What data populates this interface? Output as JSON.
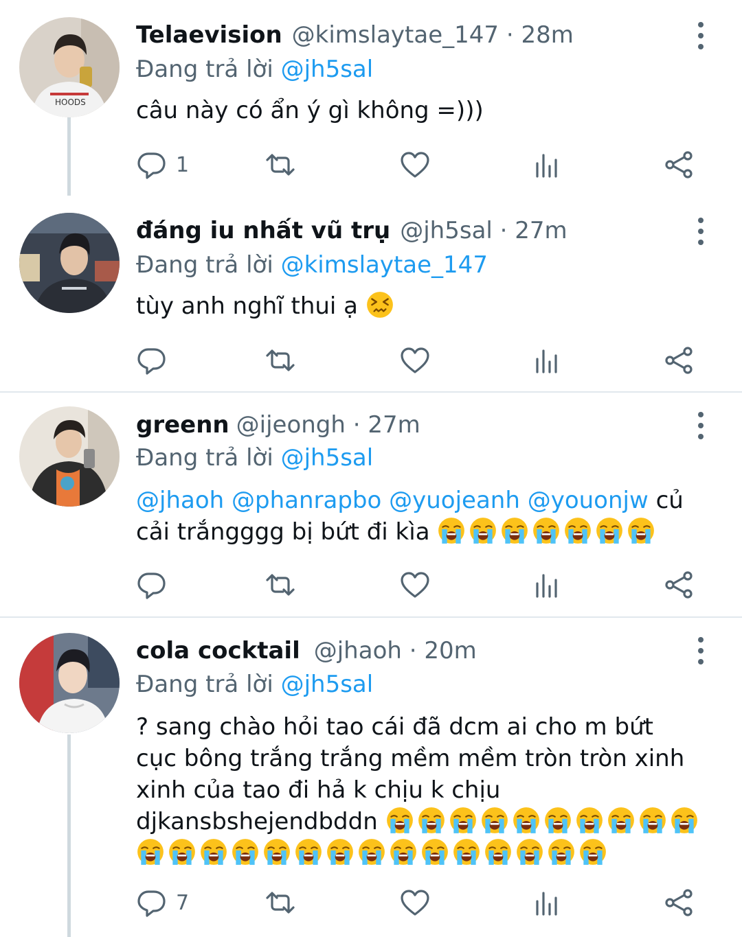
{
  "tweets": [
    {
      "name": "Telaevision",
      "handle": "@kimslaytae_147",
      "time": "28m",
      "reply_prefix": "Đang trả lời",
      "reply_to": "@jh5sal",
      "text": "câu này có ẩn ý gì không =)))",
      "replies": "1"
    },
    {
      "name": "đáng iu nhất vũ trụ",
      "handle": "@jh5sal",
      "time": "27m",
      "reply_prefix": "Đang trả lời",
      "reply_to": "@kimslaytae_147",
      "text": "tùy anh nghĩ thui ạ",
      "emoji": "confounded-face",
      "replies": ""
    },
    {
      "name": "greenn",
      "handle": "@ijeongh",
      "time": "27m",
      "reply_prefix": "Đang trả lời",
      "reply_to": "@jh5sal",
      "mentions": [
        "@jhaoh",
        "@phanrapbo",
        "@yuojeanh",
        "@youonjw"
      ],
      "text_after_mentions": "củ",
      "text_line2": "cải trắngggg bị bứt đi kìa",
      "emoji": "loudly-crying-face",
      "emoji_count": 7,
      "replies": ""
    },
    {
      "name": "cola cocktail",
      "handle": "@jhaoh",
      "time": "20m",
      "reply_prefix": "Đang trả lời",
      "reply_to": "@jh5sal",
      "text_lines": [
        "? sang chào hỏi tao cái đã dcm ai cho m bứt",
        "cục bông trắng trắng mềm mềm tròn tròn xinh",
        "xinh của tao đi hả k chịu k chịu",
        "djkansbshejendbddn"
      ],
      "emoji": "loudly-crying-face",
      "emoji_count_line4": 10,
      "emoji_count_line5": 15,
      "replies": "7"
    }
  ],
  "colors": {
    "text": "#0f1419",
    "secondary": "#536471",
    "mention": "#1d9bf0",
    "thread_line": "#cfd9de",
    "divider": "#e1e8ed"
  },
  "icons": [
    "reply-icon",
    "retweet-icon",
    "like-icon",
    "analytics-icon",
    "share-icon",
    "more-icon"
  ]
}
